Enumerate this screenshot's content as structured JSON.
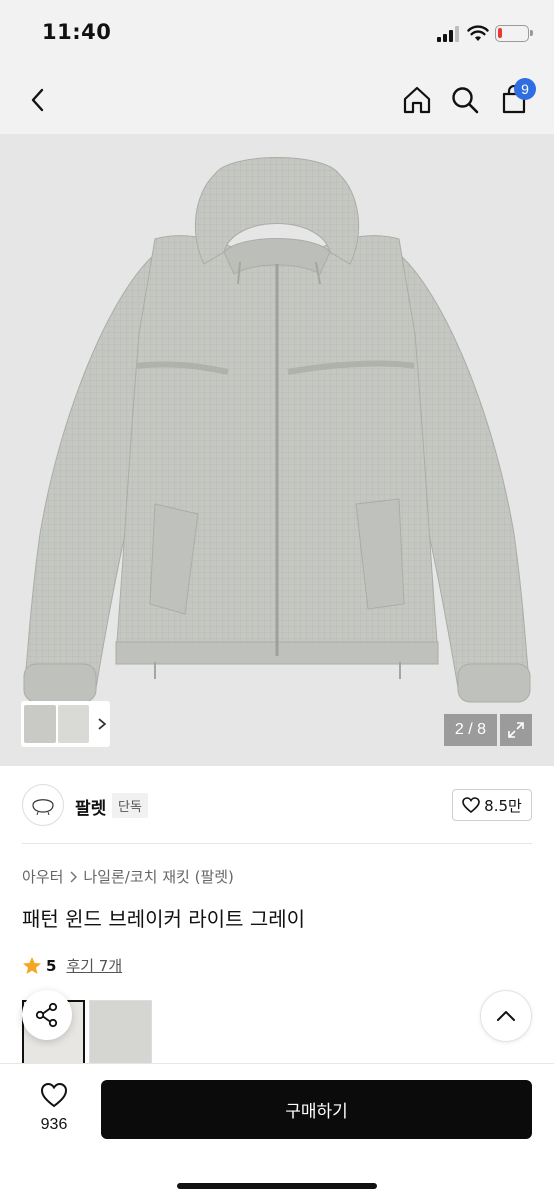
{
  "status_bar": {
    "time": "11:40"
  },
  "header": {
    "cart_count": "9"
  },
  "gallery": {
    "counter": "2 / 8"
  },
  "shop": {
    "name": "팔렛",
    "tag": "단독",
    "likes": "8.5만"
  },
  "breadcrumb": {
    "category": "아우터",
    "subcategory": "나일론/코치 재킷 (팔렛)"
  },
  "product": {
    "title": "패턴 윈드 브레이커 라이트 그레이",
    "rating": "5",
    "reviews": "후기 7개"
  },
  "bottom_bar": {
    "wish_count": "936",
    "buy_label": "구매하기"
  },
  "colors": {
    "accent_badge": "#2f6ee0",
    "star": "#f5a623",
    "buy_button": "#0b0b0b",
    "jacket": "#c4c7c1"
  }
}
